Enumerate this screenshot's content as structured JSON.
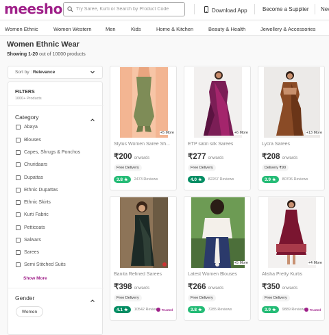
{
  "header": {
    "logo": "meesho",
    "search_placeholder": "Try Saree, Kurti or Search by Product Code",
    "download_app": "Download App",
    "become_supplier": "Become a Supplier",
    "overflow_link": "Nev"
  },
  "nav": [
    "Women Ethnic",
    "Women Western",
    "Men",
    "Kids",
    "Home & Kitchen",
    "Beauty & Health",
    "Jewellery & Accessories"
  ],
  "page": {
    "title": "Women Ethnic Wear",
    "showing_bold": "Showing 1-20",
    "showing_rest": "out of 10000 products"
  },
  "sort": {
    "prefix": "Sort by :",
    "value": "Relevance"
  },
  "filters": {
    "title": "FILTERS",
    "subtitle": "1000+ Products",
    "category_title": "Category",
    "categories": [
      "Abaya",
      "Blouses",
      "Capes, Shrugs & Ponchos",
      "Churidaars",
      "Dupattas",
      "Ethnic Dupattas",
      "Ethnic Skirts",
      "Kurti Fabric",
      "Petticoats",
      "Salwars",
      "Sarees",
      "Semi Stitched Suits"
    ],
    "show_more": "Show More",
    "gender_title": "Gender",
    "gender_option": "Women"
  },
  "products": [
    {
      "name": "Stylus Women Saree Sh...",
      "price": "₹200",
      "onwards": "onwards",
      "delivery": "Free Delivery",
      "rating": "3.8 ★",
      "rating_color": "#23bb75",
      "reviews": "2473 Reviews",
      "more": "+5 More",
      "trusted": ""
    },
    {
      "name": "ETP satin silk Sarees",
      "price": "₹277",
      "onwards": "onwards",
      "delivery": "Free Delivery",
      "rating": "4.0 ★",
      "rating_color": "#038d63",
      "reviews": "82267 Reviews",
      "more": "+6 More",
      "trusted": ""
    },
    {
      "name": "Lycra Sarees",
      "price": "₹208",
      "onwards": "onwards",
      "delivery": "Delivery ₹90",
      "rating": "3.9 ★",
      "rating_color": "#23bb75",
      "reviews": "80706 Reviews",
      "more": "+13 More",
      "trusted": ""
    },
    {
      "name": "Banita Refined Sarees",
      "price": "₹398",
      "onwards": "onwards",
      "delivery": "Free Delivery",
      "rating": "4.1 ★",
      "rating_color": "#038d63",
      "reviews": "10542 Reviews",
      "more": "",
      "trusted": "Trusted"
    },
    {
      "name": "Latest Women Blouses",
      "price": "₹266",
      "onwards": "onwards",
      "delivery": "Free Delivery",
      "rating": "3.8 ★",
      "rating_color": "#23bb75",
      "reviews": "7285 Reviews",
      "more": "+5 More",
      "trusted": ""
    },
    {
      "name": "Alisha Pretty Kurtis",
      "price": "₹350",
      "onwards": "onwards",
      "delivery": "Free Delivery",
      "rating": "3.9 ★",
      "rating_color": "#23bb75",
      "reviews": "9889 Reviews",
      "more": "+4 More",
      "trusted": "Trusted"
    }
  ]
}
